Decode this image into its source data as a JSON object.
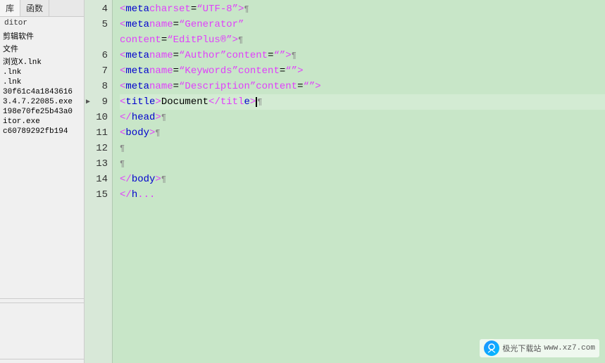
{
  "sidebar": {
    "tabs": [
      {
        "label": "库",
        "id": "lib"
      },
      {
        "label": "函数",
        "id": "func"
      }
    ],
    "dropdown_value": "",
    "label": "ditor",
    "items": [
      {
        "text": "剪辑软件"
      },
      {
        "text": "文件"
      },
      {
        "text": "浏览X.lnk"
      },
      {
        "text": ".lnk"
      },
      {
        "text": ".lnk"
      },
      {
        "text": "30f61c4a1843616"
      },
      {
        "text": "3.4.7.22085.exe"
      },
      {
        "text": "198e70fe25b43a0"
      },
      {
        "text": "itor.exe"
      },
      {
        "text": "c60789292fb194"
      }
    ]
  },
  "lines": [
    {
      "number": "4",
      "parts": [
        {
          "text": "    <",
          "class": "tag"
        },
        {
          "text": "meta",
          "class": "attr"
        },
        {
          "text": " charset",
          "class": "tag"
        },
        {
          "text": "=",
          "class": "text-content"
        },
        {
          "text": "“UTF-8”",
          "class": "value"
        },
        {
          "text": ">",
          "class": "tag"
        },
        {
          "text": "¶",
          "class": "pilcrow"
        }
      ]
    },
    {
      "number": "5",
      "parts": [
        {
          "text": "    <",
          "class": "tag"
        },
        {
          "text": "meta",
          "class": "attr"
        },
        {
          "text": " name",
          "class": "tag"
        },
        {
          "text": "=",
          "class": "text-content"
        },
        {
          "text": "“Generator”",
          "class": "value"
        },
        {
          "text": "",
          "class": "text-content"
        }
      ]
    },
    {
      "number": "",
      "parts": [
        {
          "text": "    content",
          "class": "tag"
        },
        {
          "text": "=",
          "class": "text-content"
        },
        {
          "text": "“EditPlus®”",
          "class": "value"
        },
        {
          "text": ">",
          "class": "tag"
        },
        {
          "text": "¶",
          "class": "pilcrow"
        }
      ]
    },
    {
      "number": "6",
      "parts": [
        {
          "text": "    <",
          "class": "tag"
        },
        {
          "text": "meta",
          "class": "attr"
        },
        {
          "text": " name",
          "class": "tag"
        },
        {
          "text": "=",
          "class": "text-content"
        },
        {
          "text": "“Author”",
          "class": "value"
        },
        {
          "text": " content",
          "class": "tag"
        },
        {
          "text": "=",
          "class": "text-content"
        },
        {
          "text": "“”",
          "class": "value"
        },
        {
          "text": ">",
          "class": "tag"
        },
        {
          "text": "¶",
          "class": "pilcrow"
        }
      ]
    },
    {
      "number": "7",
      "parts": [
        {
          "text": "    <",
          "class": "tag"
        },
        {
          "text": "meta",
          "class": "attr"
        },
        {
          "text": " name",
          "class": "tag"
        },
        {
          "text": "=",
          "class": "text-content"
        },
        {
          "text": "“Keywords”",
          "class": "value"
        },
        {
          "text": " content",
          "class": "tag"
        },
        {
          "text": "=",
          "class": "text-content"
        },
        {
          "text": "“”",
          "class": "value"
        },
        {
          "text": ">",
          "class": "tag"
        }
      ]
    },
    {
      "number": "8",
      "parts": [
        {
          "text": "    <",
          "class": "tag"
        },
        {
          "text": "meta",
          "class": "attr"
        },
        {
          "text": " name",
          "class": "tag"
        },
        {
          "text": "=",
          "class": "text-content"
        },
        {
          "text": "“Description”",
          "class": "value"
        },
        {
          "text": " content",
          "class": "tag"
        },
        {
          "text": "=",
          "class": "text-content"
        },
        {
          "text": "“”",
          "class": "value"
        },
        {
          "text": ">",
          "class": "tag"
        }
      ]
    },
    {
      "number": "9",
      "parts": [
        {
          "text": "    <",
          "class": "tag"
        },
        {
          "text": "title",
          "class": "attr"
        },
        {
          "text": ">",
          "class": "tag"
        },
        {
          "text": "Document",
          "class": "text-content"
        },
        {
          "text": "</titl",
          "class": "tag"
        },
        {
          "text": "e",
          "class": "attr"
        },
        {
          "text": ">",
          "class": "tag"
        },
        {
          "text": "¶",
          "class": "pilcrow"
        }
      ],
      "active": true
    },
    {
      "number": "10",
      "parts": [
        {
          "text": "  </",
          "class": "tag"
        },
        {
          "text": "head",
          "class": "attr"
        },
        {
          "text": ">",
          "class": "tag"
        },
        {
          "text": "¶",
          "class": "pilcrow"
        }
      ]
    },
    {
      "number": "11",
      "parts": [
        {
          "text": "  <",
          "class": "tag"
        },
        {
          "text": "body",
          "class": "attr"
        },
        {
          "text": ">",
          "class": "tag"
        },
        {
          "text": "¶",
          "class": "pilcrow"
        }
      ]
    },
    {
      "number": "12",
      "parts": [
        {
          "text": "    ¶",
          "class": "pilcrow"
        }
      ]
    },
    {
      "number": "13",
      "parts": [
        {
          "text": "  ¶",
          "class": "pilcrow"
        }
      ]
    },
    {
      "number": "14",
      "parts": [
        {
          "text": "  </",
          "class": "tag"
        },
        {
          "text": "body",
          "class": "attr"
        },
        {
          "text": ">",
          "class": "tag"
        },
        {
          "text": "¶",
          "class": "pilcrow"
        }
      ]
    },
    {
      "number": "15",
      "parts": [
        {
          "text": "  </",
          "class": "tag"
        },
        {
          "text": "h",
          "class": "attr"
        },
        {
          "text": "...",
          "class": "tag"
        }
      ]
    }
  ],
  "watermark": {
    "url": "www.xz7.com",
    "label": "极光下载站"
  }
}
